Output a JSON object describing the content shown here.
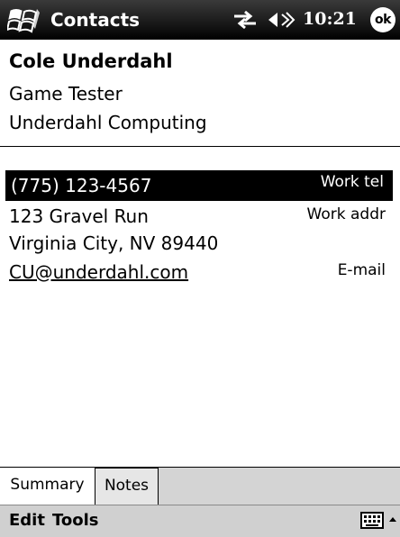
{
  "titlebar": {
    "app_title": "Contacts",
    "clock": "10:21",
    "ok_label": "ok",
    "icons": [
      "windows-start-icon",
      "connectivity-icon",
      "volume-icon"
    ],
    "bg_color": "#000000"
  },
  "contact": {
    "name": "Cole Underdahl",
    "job_title": "Game Tester",
    "company": "Underdahl Computing"
  },
  "details": {
    "phone": {
      "value": "(775) 123-4567",
      "label": "Work tel",
      "selected": true
    },
    "address": {
      "line1": "123 Gravel Run",
      "line2": "Virginia City, NV 89440",
      "label": "Work addr"
    },
    "email": {
      "value": "CU@underdahl.com",
      "label": "E-mail"
    }
  },
  "tabs": [
    {
      "label": "Summary",
      "active": true
    },
    {
      "label": "Notes",
      "active": false
    }
  ],
  "menubar": {
    "items": [
      "Edit",
      "Tools"
    ],
    "icons": [
      "keyboard-icon",
      "up-arrow-icon"
    ]
  }
}
